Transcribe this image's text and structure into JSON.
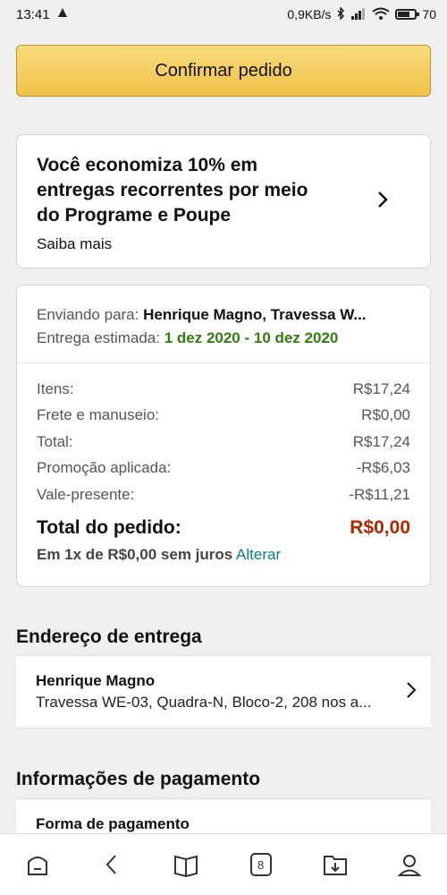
{
  "status_bar": {
    "time": "13:41",
    "speed": "0,9KB/s",
    "battery": "70"
  },
  "confirm_button": "Confirmar pedido",
  "promo": {
    "title": "Você economiza 10% em entregas recorrentes por meio do Programe e Poupe",
    "link": "Saiba mais"
  },
  "shipping": {
    "to_label": "Enviando para:",
    "to_value": "Henrique Magno, Travessa W...",
    "eta_label": "Entrega estimada:",
    "eta_value": "1 dez 2020 - 10 dez 2020"
  },
  "summary": {
    "rows": [
      {
        "label": "Itens:",
        "value": "R$17,24"
      },
      {
        "label": "Frete e manuseio:",
        "value": "R$0,00"
      },
      {
        "label": "Total:",
        "value": "R$17,24"
      },
      {
        "label": "Promoção aplicada:",
        "value": "-R$6,03"
      },
      {
        "label": "Vale-presente:",
        "value": "-R$11,21"
      }
    ],
    "total_label": "Total do pedido:",
    "total_value": "R$0,00",
    "installments": "Em 1x de R$0,00 sem juros",
    "change_link": "Alterar"
  },
  "address": {
    "section_title": "Endereço de entrega",
    "name": "Henrique Magno",
    "line": "Travessa WE-03, Quadra-N, Bloco-2, 208 nos a..."
  },
  "payment": {
    "section_title": "Informações de pagamento",
    "label": "Forma de pagamento"
  },
  "bottom_nav": {
    "tabs_count": "8"
  }
}
